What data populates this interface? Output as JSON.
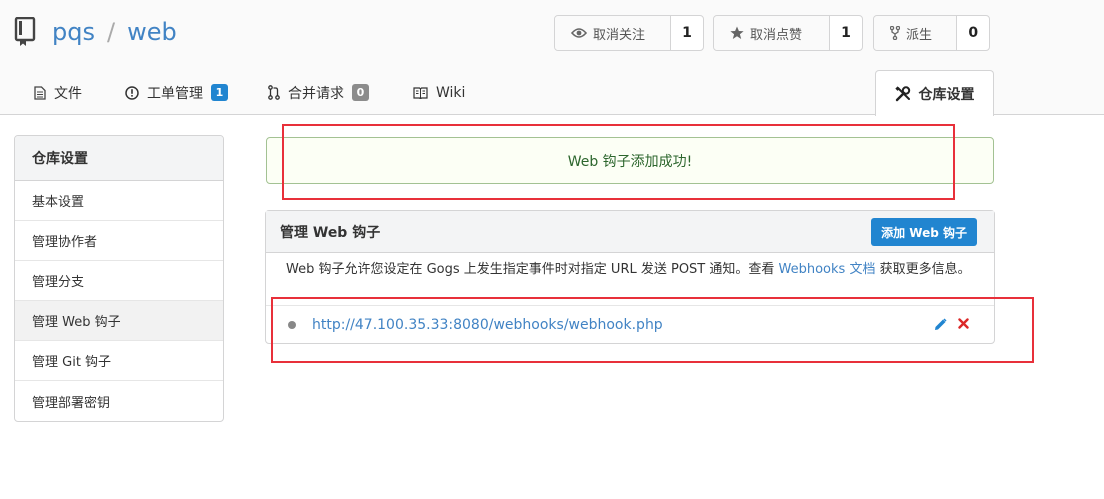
{
  "repo": {
    "owner": "pqs",
    "separator": "/",
    "name": "web"
  },
  "actions": {
    "watch": {
      "label": "取消关注",
      "count": "1"
    },
    "star": {
      "label": "取消点赞",
      "count": "1"
    },
    "fork": {
      "label": "派生",
      "count": "0"
    }
  },
  "tabs": {
    "files": {
      "label": "文件"
    },
    "issues": {
      "label": "工单管理",
      "badge": "1"
    },
    "pulls": {
      "label": "合并请求",
      "badge": "0"
    },
    "wiki": {
      "label": "Wiki"
    },
    "settings": {
      "label": "仓库设置"
    }
  },
  "sidebar": {
    "title": "仓库设置",
    "items": [
      {
        "label": "基本设置"
      },
      {
        "label": "管理协作者"
      },
      {
        "label": "管理分支"
      },
      {
        "label": "管理 Web 钩子"
      },
      {
        "label": "管理 Git 钩子"
      },
      {
        "label": "管理部署密钥"
      }
    ],
    "active_index": 3
  },
  "flash": {
    "message": "Web 钩子添加成功!"
  },
  "webhooks": {
    "title": "管理 Web 钩子",
    "add_button": "添加 Web 钩子",
    "description_before": "Web 钩子允许您设定在 Gogs 上发生指定事件时对指定 URL 发送 POST 通知。查看 ",
    "description_link": "Webhooks 文档",
    "description_after": " 获取更多信息。",
    "hooks": [
      {
        "url": "http://47.100.35.33:8080/webhooks/webhook.php"
      }
    ]
  },
  "colors": {
    "link": "#4183c4",
    "primary": "#2185d0",
    "success_text": "#2c662d",
    "annotation": "#e8303a",
    "delete": "#db2828"
  }
}
